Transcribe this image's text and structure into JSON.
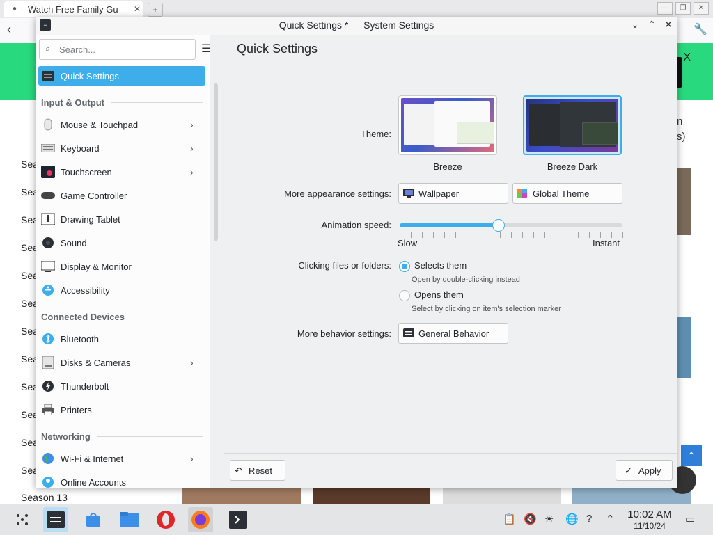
{
  "browser": {
    "tab_title": "Watch Free Family Gu",
    "side_text": [
      "n",
      "s)"
    ],
    "season_prefix": "Sea",
    "season_bottom": "Season 13"
  },
  "window": {
    "title": "Quick Settings * — System Settings"
  },
  "sidebar": {
    "search_placeholder": "Search...",
    "items": [
      {
        "label": "Quick Settings",
        "icon": "quick-settings-icon",
        "active": true
      },
      {
        "label": "Mouse & Touchpad",
        "icon": "mouse-icon",
        "chevron": true
      },
      {
        "label": "Keyboard",
        "icon": "keyboard-icon",
        "chevron": true
      },
      {
        "label": "Touchscreen",
        "icon": "touchscreen-icon",
        "chevron": true
      },
      {
        "label": "Game Controller",
        "icon": "gamepad-icon"
      },
      {
        "label": "Drawing Tablet",
        "icon": "tablet-icon"
      },
      {
        "label": "Sound",
        "icon": "sound-icon"
      },
      {
        "label": "Display & Monitor",
        "icon": "monitor-icon"
      },
      {
        "label": "Accessibility",
        "icon": "accessibility-icon"
      },
      {
        "label": "Bluetooth",
        "icon": "bluetooth-icon"
      },
      {
        "label": "Disks & Cameras",
        "icon": "disks-icon",
        "chevron": true
      },
      {
        "label": "Thunderbolt",
        "icon": "thunderbolt-icon"
      },
      {
        "label": "Printers",
        "icon": "printer-icon"
      },
      {
        "label": "Wi-Fi & Internet",
        "icon": "globe-icon",
        "chevron": true
      },
      {
        "label": "Online Accounts",
        "icon": "accounts-icon"
      }
    ],
    "sections": {
      "input_output": "Input & Output",
      "connected_devices": "Connected Devices",
      "networking": "Networking"
    }
  },
  "main": {
    "page_title": "Quick Settings",
    "theme_label": "Theme:",
    "themes": [
      {
        "name": "Breeze",
        "selected": false
      },
      {
        "name": "Breeze Dark",
        "selected": true
      }
    ],
    "more_appearance_label": "More appearance settings:",
    "wallpaper_button": "Wallpaper",
    "global_theme_button": "Global Theme",
    "animation_label": "Animation speed:",
    "animation_value": 0.44,
    "slider_min_label": "Slow",
    "slider_max_label": "Instant",
    "clicking_label": "Clicking files or folders:",
    "radio_options": [
      {
        "label": "Selects them",
        "help": "Open by double-clicking instead",
        "checked": true
      },
      {
        "label": "Opens them",
        "help": "Select by clicking on item's selection marker",
        "checked": false
      }
    ],
    "more_behavior_label": "More behavior settings:",
    "general_behavior_button": "General Behavior"
  },
  "footer": {
    "reset_label": "Reset",
    "apply_label": "Apply"
  },
  "taskbar": {
    "time": "10:02 AM",
    "date": "11/10/24"
  },
  "colors": {
    "accent": "#3daee9",
    "window_bg": "#eff0f1",
    "banner_green": "#29d97e"
  }
}
